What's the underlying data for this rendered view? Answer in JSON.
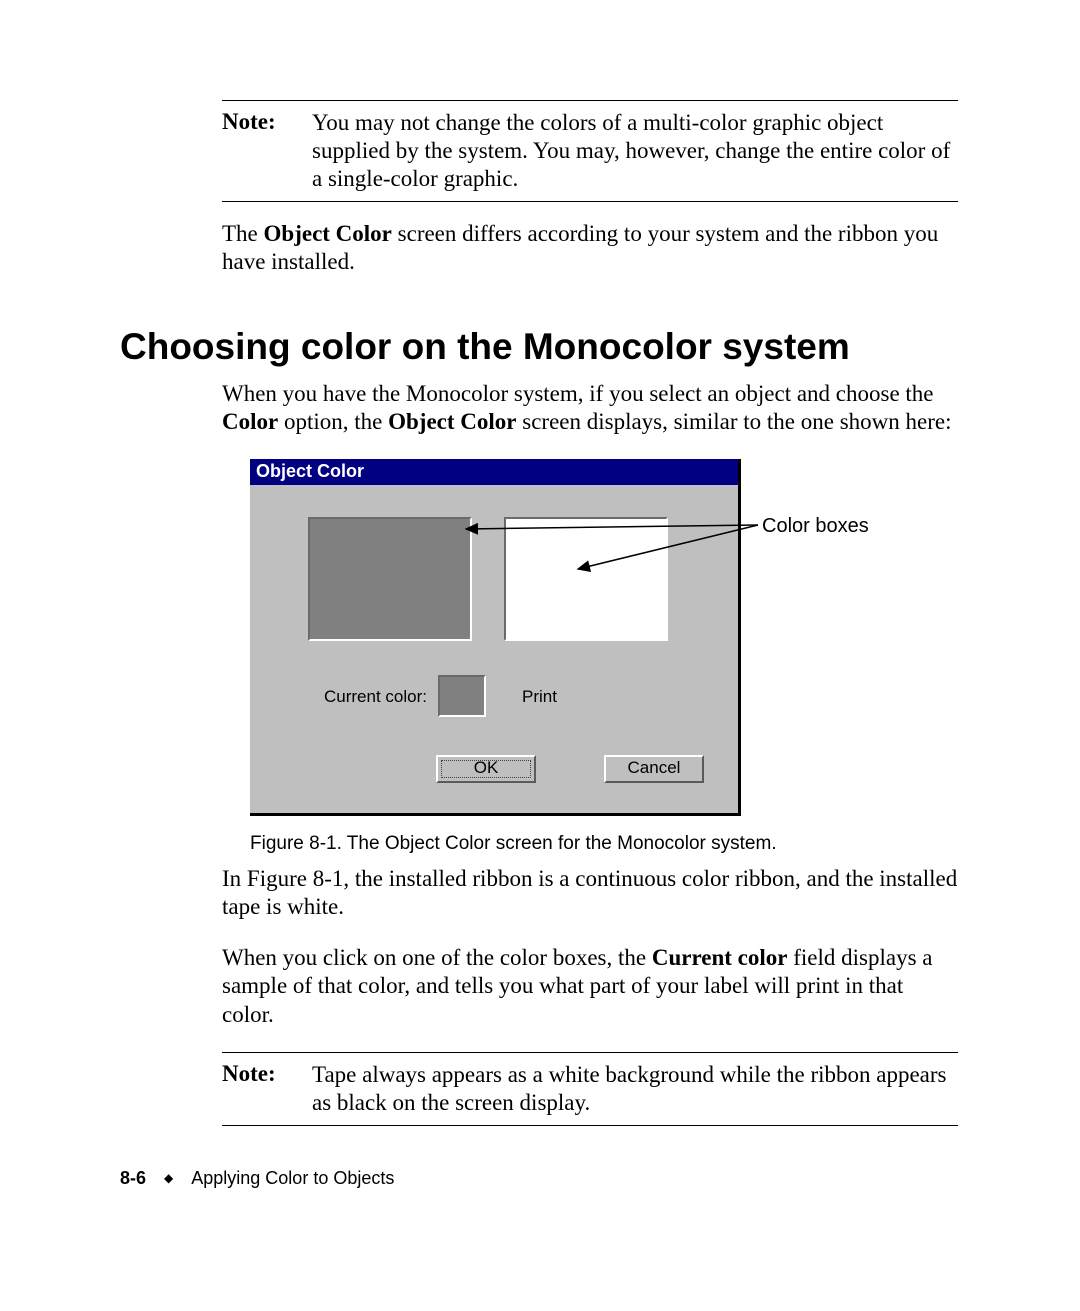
{
  "note1": {
    "label": "Note:",
    "text": "You may not change the colors of a multi-color graphic object supplied by the system. You may, however, change the entire color of a single-color graphic."
  },
  "para_after_note1": {
    "pre": "The ",
    "bold": "Object Color",
    "post": " screen differs according to your system and the ribbon you have installed."
  },
  "heading": "Choosing color on the Monocolor system",
  "para_intro": {
    "p1": "When you have the Monocolor system, if you select an object and choose the ",
    "b1": "Color",
    "p2": " option, the ",
    "b2": "Object Color",
    "p3": " screen displays, similar to the one shown here:"
  },
  "dialog": {
    "title": "Object Color",
    "current_label": "Current color:",
    "print_label": "Print",
    "ok": "OK",
    "cancel": "Cancel"
  },
  "callout": "Color boxes",
  "figure_caption": "Figure 8-1. The Object Color screen for the Monocolor system.",
  "para_after_fig": "In Figure 8-1, the installed ribbon is a continuous color ribbon, and the installed tape is white.",
  "para_click": {
    "p1": "When you click on one of the color boxes, the ",
    "b1": "Current color",
    "p2": " field displays a sample of that color, and tells you what part of your label will print in that color."
  },
  "note2": {
    "label": "Note:",
    "text": "Tape always appears as a white background while the ribbon appears as black on the screen display."
  },
  "footer": {
    "page": "8-6",
    "section": "Applying Color to Objects"
  }
}
